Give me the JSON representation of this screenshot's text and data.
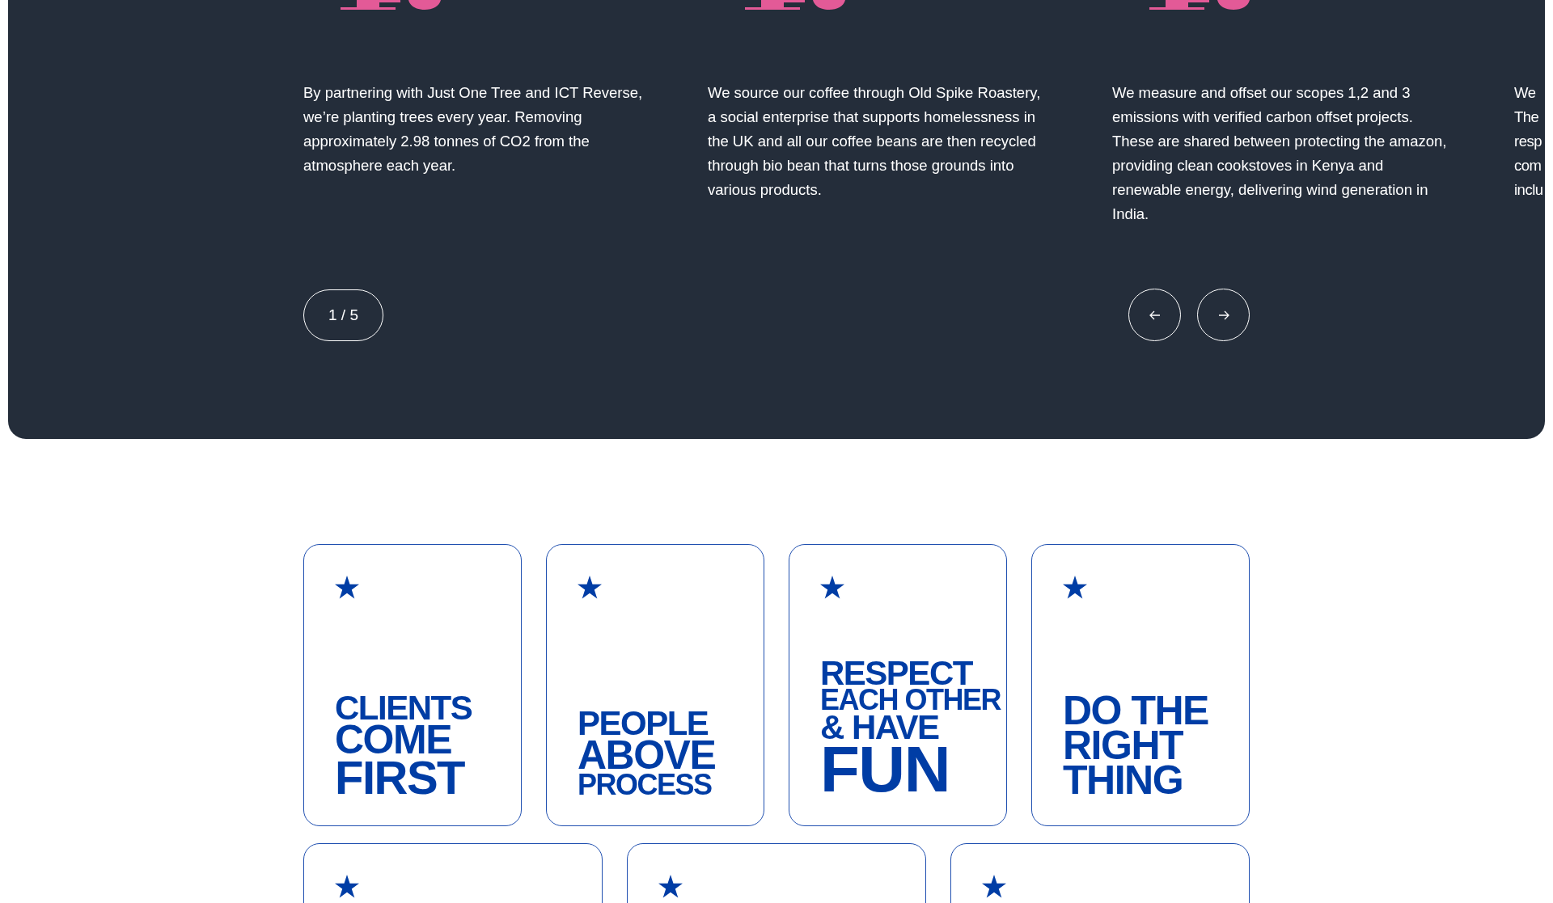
{
  "impact_slider": {
    "slides": [
      {
        "text": "By partnering with Just One Tree and ICT Reverse, we’re planting trees every year. Removing approximately 2.98 tonnes of CO2 from the atmosphere each year."
      },
      {
        "text": "We source our coffee through Old Spike Roastery, a social enterprise that supports homelessness in the UK and all our coffee beans are then recycled through bio bean that turns those grounds into various products."
      },
      {
        "text": "We measure and offset our scopes 1,2 and 3 emissions with verified carbon offset projects. These are shared between protecting the amazon, providing clean cookstoves in Kenya and renewable energy, delivering wind generation in India."
      },
      {
        "text_lines": [
          "We",
          "The",
          "resp",
          "com",
          "inclu"
        ]
      }
    ],
    "counter": "1 / 5"
  },
  "values": [
    {
      "kind": "card",
      "lines": [
        {
          "text": "CLIENTS",
          "kind": "medium"
        },
        {
          "text": "COME",
          "kind": "large"
        },
        {
          "text": "FIRST",
          "kind": "xlarge"
        }
      ]
    },
    {
      "kind": "card",
      "lines": [
        {
          "text": "PEOPLE",
          "kind": "medium"
        },
        {
          "text": "ABOVE",
          "kind": "large"
        },
        {
          "text": "PROCESS",
          "kind": "small"
        }
      ]
    },
    {
      "kind": "card",
      "lines": [
        {
          "text": "RESPECT",
          "kind": "medium"
        },
        {
          "text": "EACH OTHER",
          "kind": "small"
        },
        {
          "text": "& HAVE",
          "kind": "medium"
        },
        {
          "text": "FUN",
          "kind": "huge"
        }
      ]
    },
    {
      "kind": "card",
      "lines": [
        {
          "text": "DO THE",
          "kind": "large"
        },
        {
          "text": "RIGHT",
          "kind": "large"
        },
        {
          "text": "THING",
          "kind": "large"
        }
      ]
    },
    {
      "kind": "wide-card"
    },
    {
      "kind": "wide-card"
    },
    {
      "kind": "wide-card"
    }
  ]
}
